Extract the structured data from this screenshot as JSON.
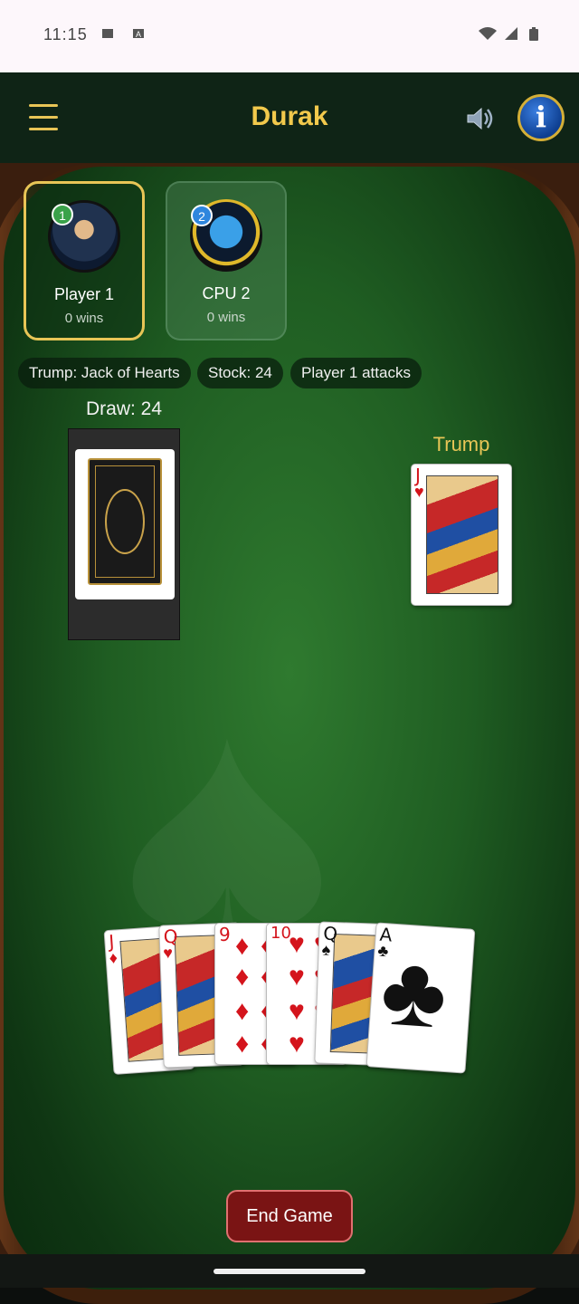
{
  "status_bar": {
    "time": "11:15"
  },
  "header": {
    "title": "Durak",
    "menu_icon": "hamburger-icon",
    "sound_icon": "speaker-icon",
    "info_icon": "info-icon",
    "info_glyph": "i",
    "accent": "#f2c94c"
  },
  "players": [
    {
      "badge": "1",
      "name": "Player 1",
      "wins": "0 wins",
      "active": true
    },
    {
      "badge": "2",
      "name": "CPU 2",
      "wins": "0 wins",
      "active": false
    }
  ],
  "chips": {
    "trump": "Trump: Jack of Hearts",
    "stock": "Stock: 24",
    "turn": "Player 1 attacks"
  },
  "draw_label": "Draw: 24",
  "trump_label": "Trump",
  "trump_card": {
    "rank": "J",
    "suit": "♥"
  },
  "hand": [
    {
      "rank": "J",
      "suit": "♦"
    },
    {
      "rank": "Q",
      "suit": "♥"
    },
    {
      "rank": "9",
      "suit": "♦"
    },
    {
      "rank": "10",
      "suit": "♥"
    },
    {
      "rank": "Q",
      "suit": "♠"
    },
    {
      "rank": "A",
      "suit": "♣"
    }
  ],
  "end_game_label": "End Game"
}
